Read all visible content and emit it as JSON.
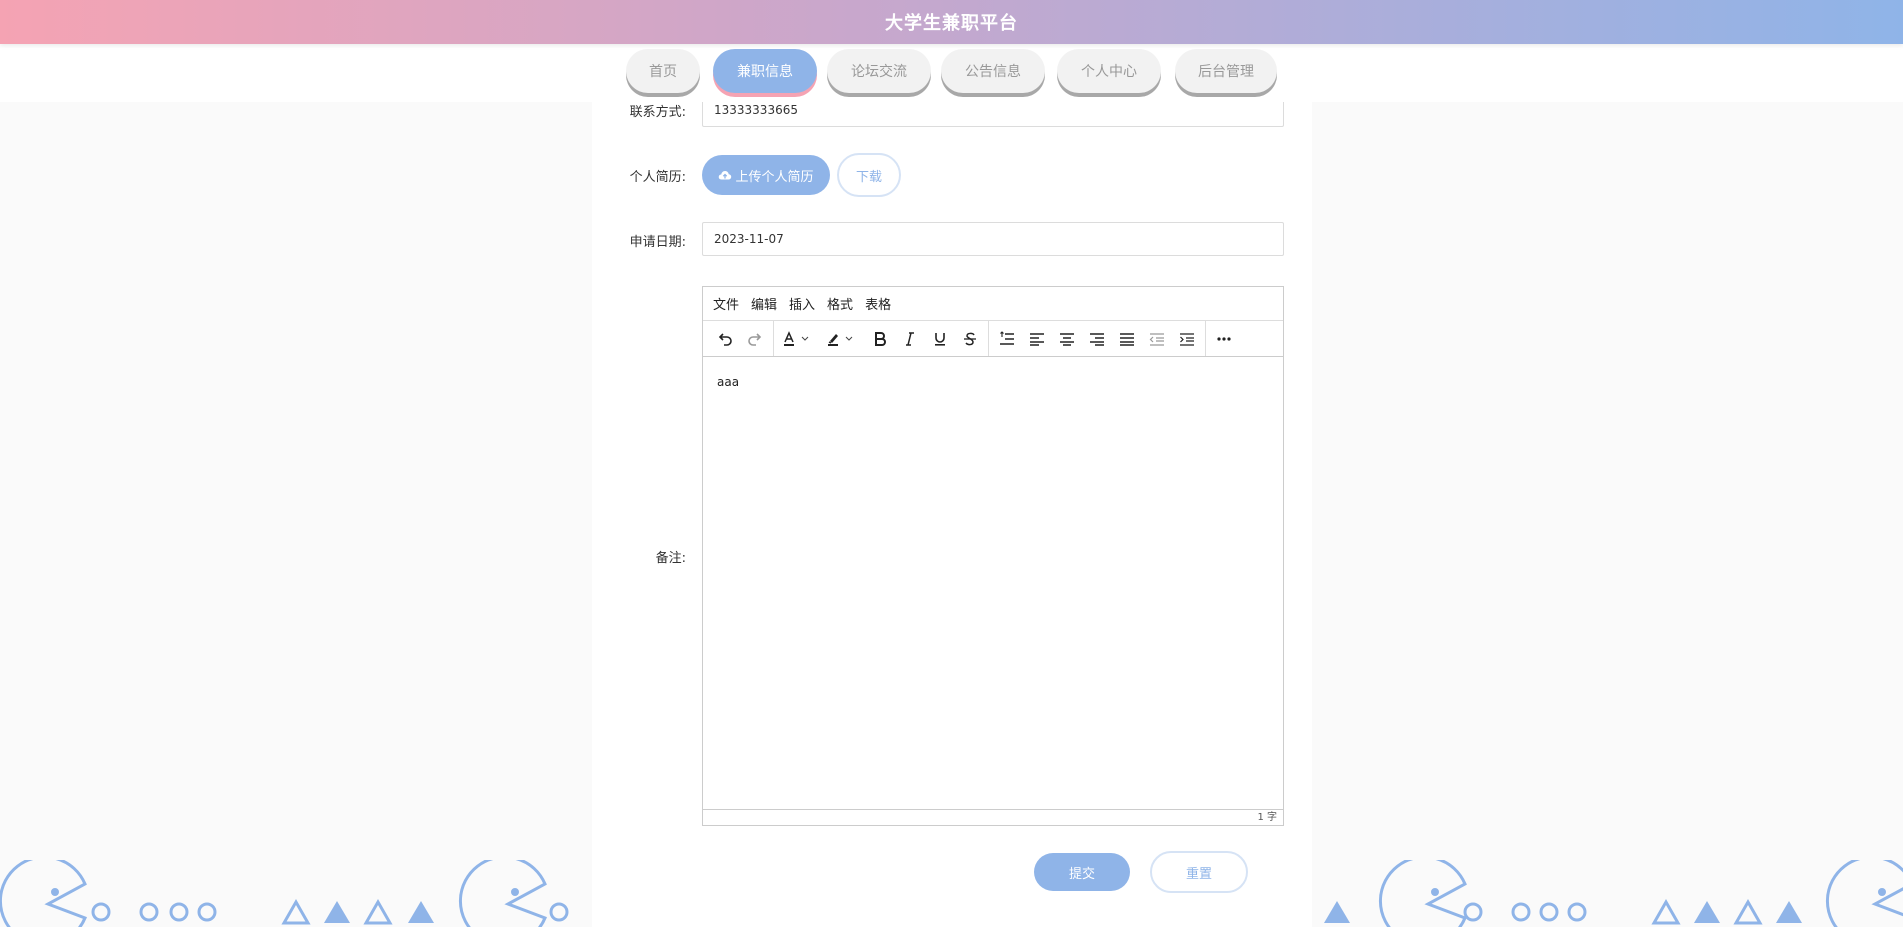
{
  "header": {
    "title": "大学生兼职平台"
  },
  "nav": {
    "tabs": [
      {
        "label": "首页"
      },
      {
        "label": "兼职信息"
      },
      {
        "label": "论坛交流"
      },
      {
        "label": "公告信息"
      },
      {
        "label": "个人中心"
      },
      {
        "label": "后台管理"
      }
    ],
    "active_index": 1
  },
  "form": {
    "contact": {
      "label": "联系方式:",
      "value": "13333333665"
    },
    "resume": {
      "label": "个人简历:",
      "upload_label": "上传个人简历",
      "download_label": "下载"
    },
    "apply_date": {
      "label": "申请日期:",
      "value": "2023-11-07"
    },
    "remark": {
      "label": "备注:",
      "menu": [
        "文件",
        "编辑",
        "插入",
        "格式",
        "表格"
      ],
      "content": "aaa",
      "word_count": "1 字"
    },
    "submit_label": "提交",
    "reset_label": "重置"
  },
  "colors": {
    "accent": "#8fb4e8",
    "pink": "#f5a3b3"
  }
}
